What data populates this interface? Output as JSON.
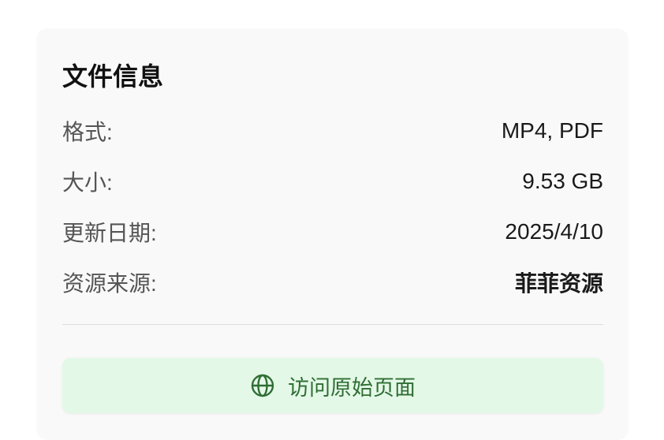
{
  "file_info": {
    "title": "文件信息",
    "rows": [
      {
        "label": "格式:",
        "value": "MP4, PDF"
      },
      {
        "label": "大小:",
        "value": "9.53 GB"
      },
      {
        "label": "更新日期:",
        "value": "2025/4/10"
      },
      {
        "label": "资源来源:",
        "value": "菲菲资源"
      }
    ],
    "visit_button": {
      "label": "访问原始页面",
      "icon": "globe-icon"
    }
  },
  "colors": {
    "card_bg": "#f9f9f9",
    "button_bg": "#e4f8e7",
    "button_text": "#2f6e34"
  }
}
